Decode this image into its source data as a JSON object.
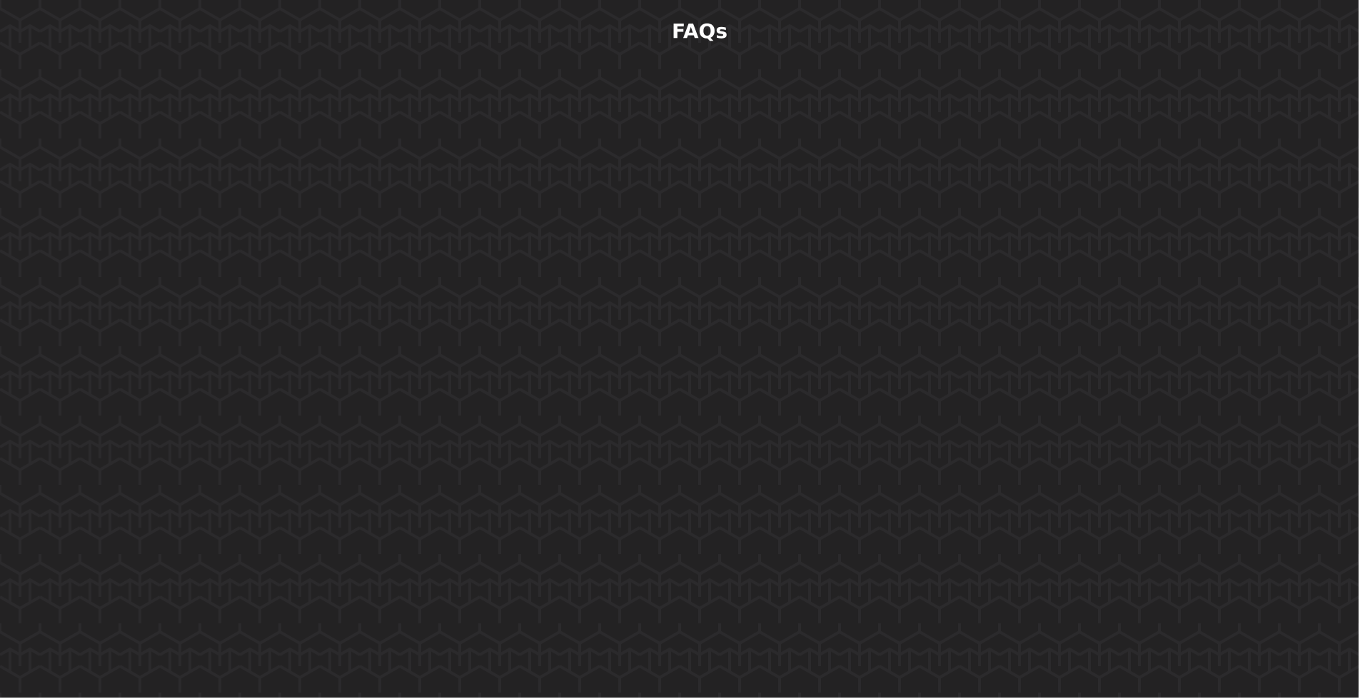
{
  "page": {
    "title": "FAQs"
  },
  "colors": {
    "background": "#232223",
    "pattern_stroke": "#2a292b",
    "title_text": "#ffffff"
  }
}
